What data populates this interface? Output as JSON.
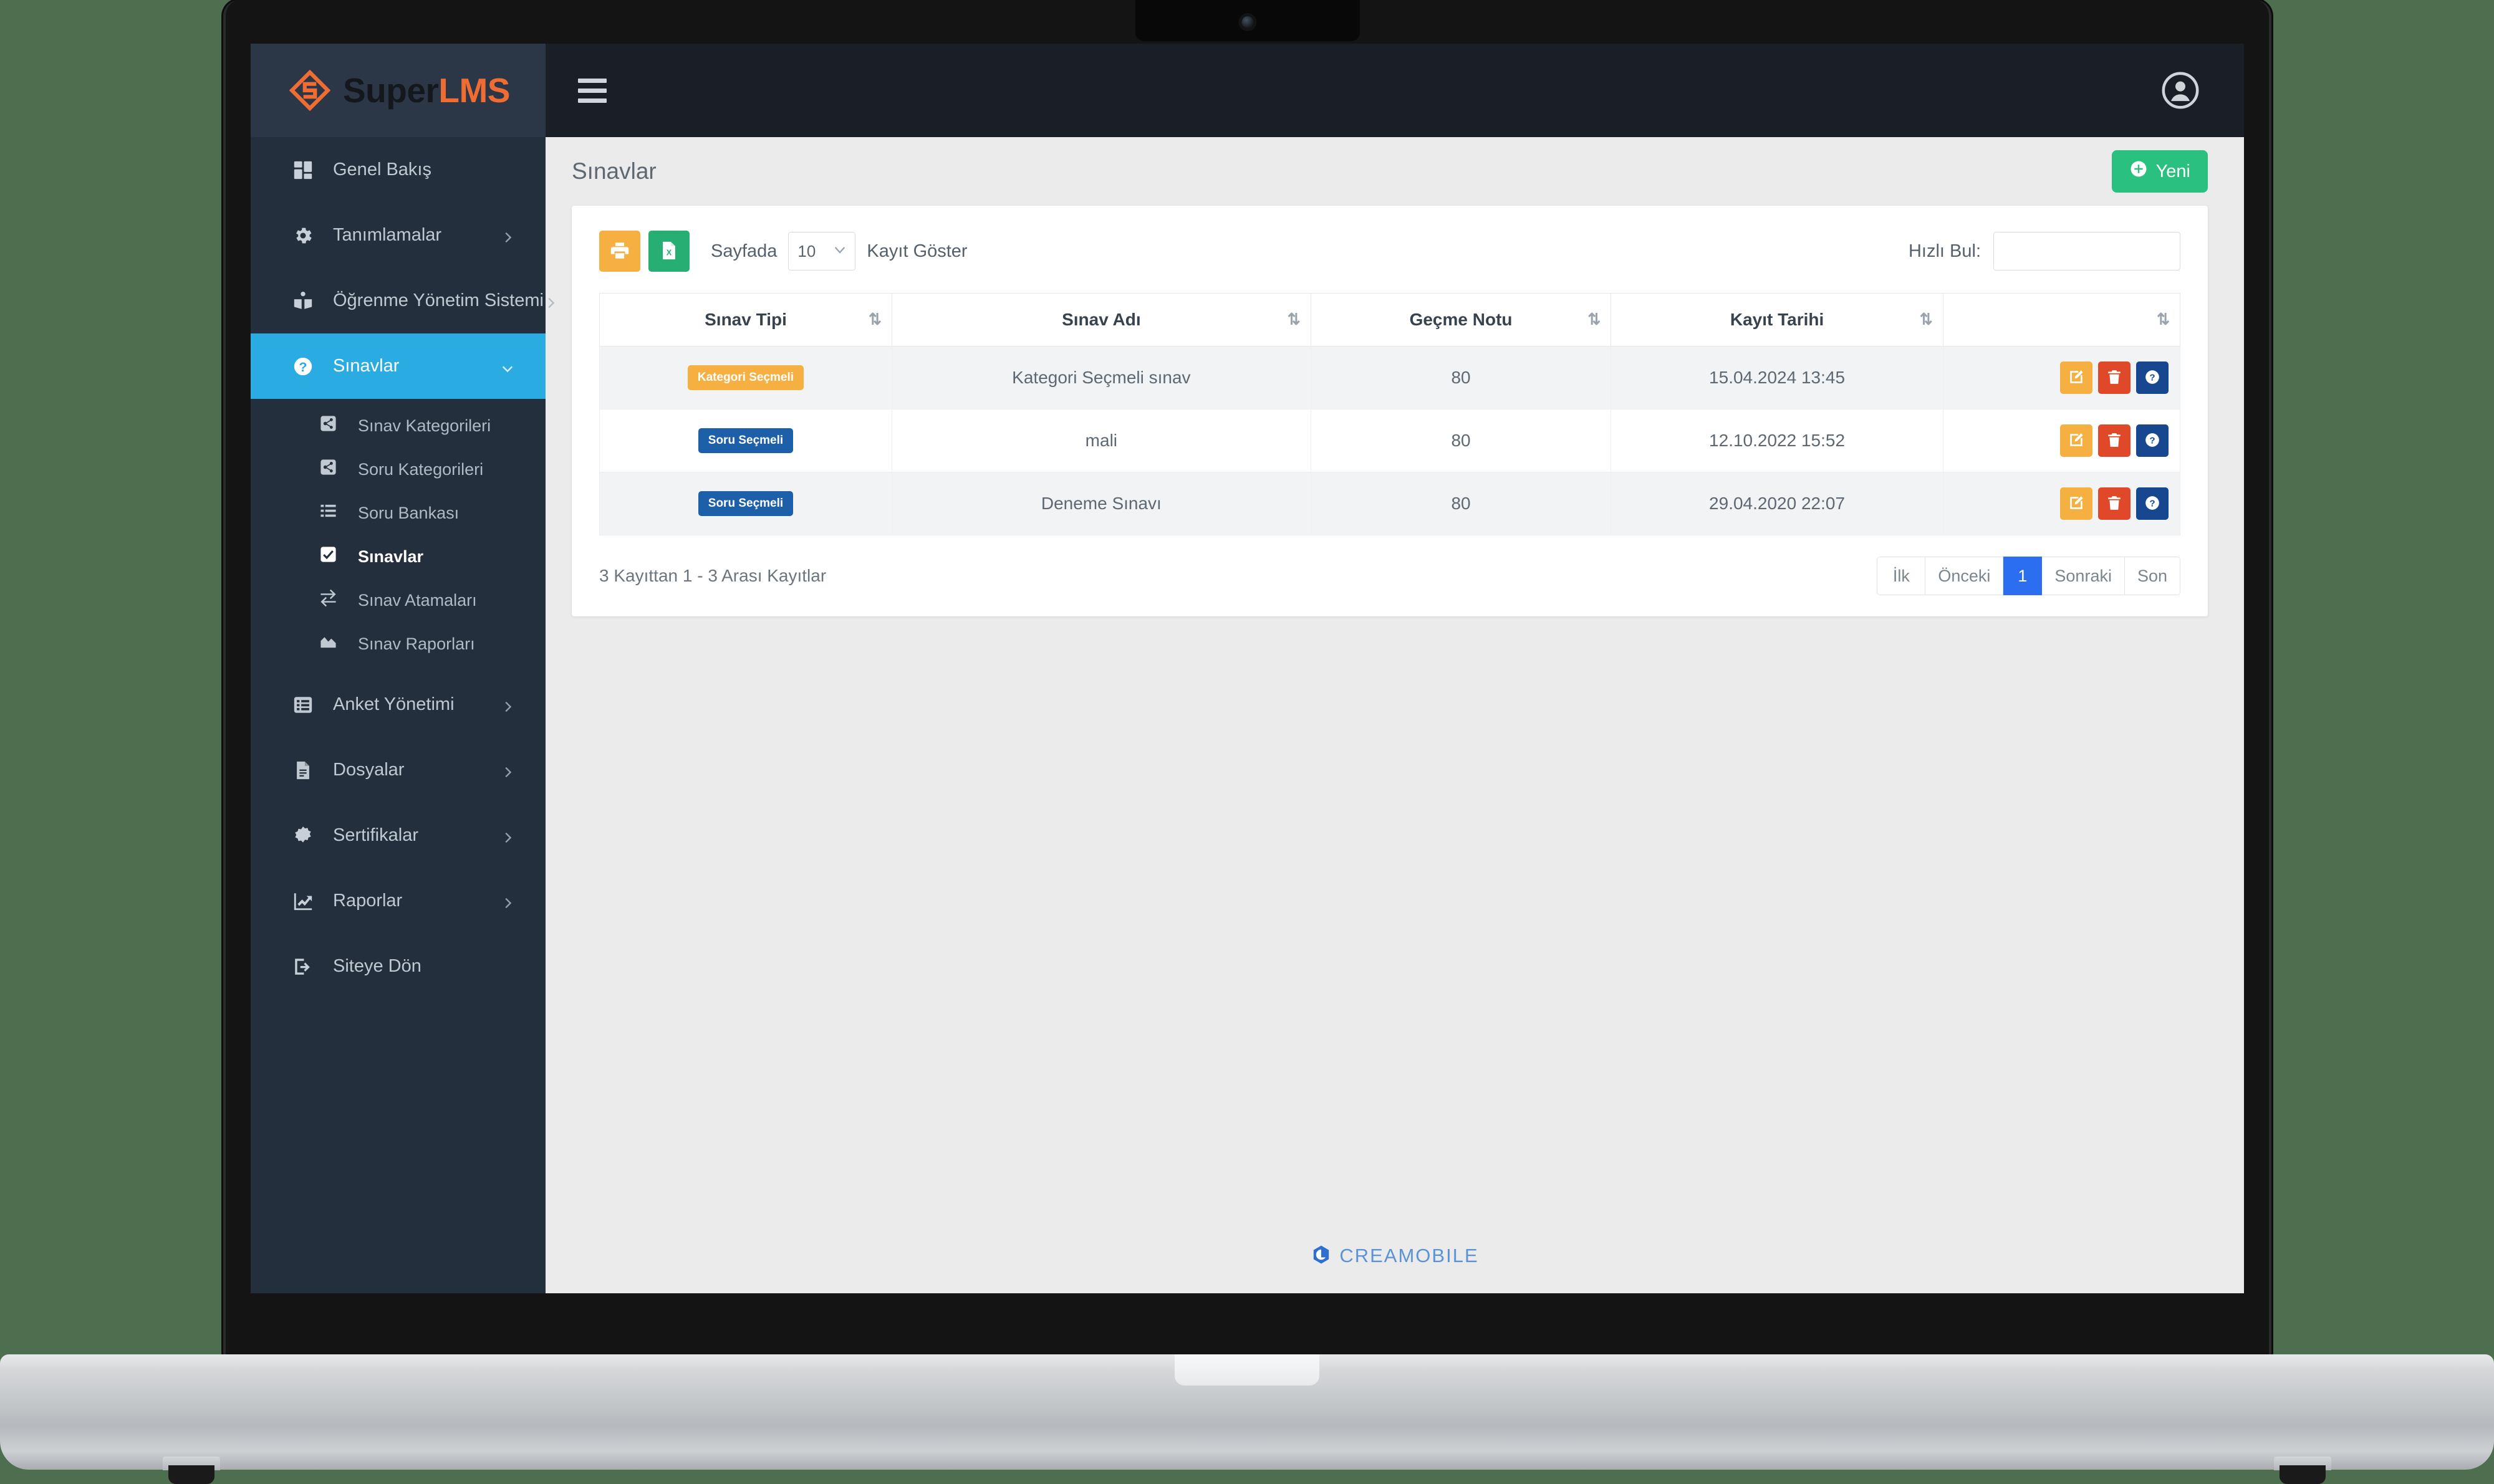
{
  "brand": {
    "name_primary": "Super",
    "name_accent": "LMS",
    "accent_color": "#ef6c33"
  },
  "topbar": {
    "menu_toggle_label": "menu",
    "user_menu_label": "user"
  },
  "page": {
    "title": "Sınavlar",
    "new_button_label": "Yeni"
  },
  "sidebar": {
    "items": [
      {
        "label": "Genel Bakış",
        "icon": "dashboard-icon",
        "has_caret": false,
        "active": false
      },
      {
        "label": "Tanımlamalar",
        "icon": "gear-icon",
        "has_caret": true,
        "active": false
      },
      {
        "label": "Öğrenme Yönetim Sistemi",
        "icon": "graduation-icon",
        "has_caret": true,
        "active": false
      },
      {
        "label": "Sınavlar",
        "icon": "question-circle-icon",
        "has_caret": true,
        "active": true
      }
    ],
    "submenu": [
      {
        "label": "Sınav Kategorileri",
        "icon": "sitemap-icon",
        "current": false
      },
      {
        "label": "Soru Kategorileri",
        "icon": "sitemap-icon",
        "current": false
      },
      {
        "label": "Soru Bankası",
        "icon": "list-icon",
        "current": false
      },
      {
        "label": "Sınavlar",
        "icon": "check-square-icon",
        "current": true
      },
      {
        "label": "Sınav Atamaları",
        "icon": "exchange-icon",
        "current": false
      },
      {
        "label": "Sınav Raporları",
        "icon": "chart-area-icon",
        "current": false
      }
    ],
    "items_after": [
      {
        "label": "Anket Yönetimi",
        "icon": "table-list-icon",
        "has_caret": true
      },
      {
        "label": "Dosyalar",
        "icon": "file-icon",
        "has_caret": true
      },
      {
        "label": "Sertifikalar",
        "icon": "certificate-icon",
        "has_caret": true
      },
      {
        "label": "Raporlar",
        "icon": "chart-line-icon",
        "has_caret": true
      },
      {
        "label": "Siteye Dön",
        "icon": "sign-out-icon",
        "has_caret": false
      }
    ]
  },
  "toolbar": {
    "print_button_label": "print",
    "excel_button_label": "excel",
    "length_prefix": "Sayfada",
    "length_value": "10",
    "length_suffix": "Kayıt Göster",
    "search_label": "Hızlı Bul:",
    "search_value": "",
    "search_placeholder": ""
  },
  "table": {
    "columns": [
      {
        "label": "Sınav Tipi",
        "sortable": true
      },
      {
        "label": "Sınav Adı",
        "sortable": true
      },
      {
        "label": "Geçme Notu",
        "sortable": true
      },
      {
        "label": "Kayıt Tarihi",
        "sortable": true
      },
      {
        "label": "",
        "sortable": true
      }
    ],
    "rows": [
      {
        "type_badge": "Kategori Seçmeli",
        "type_badge_style": "kategori",
        "name": "Kategori Seçmeli sınav",
        "pass_grade": "80",
        "created_at": "15.04.2024 13:45"
      },
      {
        "type_badge": "Soru Seçmeli",
        "type_badge_style": "soru",
        "name": "mali",
        "pass_grade": "80",
        "created_at": "12.10.2022 15:52"
      },
      {
        "type_badge": "Soru Seçmeli",
        "type_badge_style": "soru",
        "name": "Deneme Sınavı",
        "pass_grade": "80",
        "created_at": "29.04.2020 22:07"
      }
    ],
    "row_actions": [
      {
        "name": "edit-button",
        "style": "act-edit",
        "icon": "pencil-square-icon"
      },
      {
        "name": "delete-button",
        "style": "act-delete",
        "icon": "trash-icon"
      },
      {
        "name": "info-button",
        "style": "act-info",
        "icon": "question-circle-icon"
      }
    ]
  },
  "footer_table": {
    "record_info": "3 Kayıttan 1 - 3 Arası Kayıtlar",
    "pagination": [
      {
        "label": "İlk",
        "active": false
      },
      {
        "label": "Önceki",
        "active": false
      },
      {
        "label": "1",
        "active": true
      },
      {
        "label": "Sonraki",
        "active": false
      },
      {
        "label": "Son",
        "active": false
      }
    ]
  },
  "app_footer": {
    "logo_text": "CREAMOBILE",
    "logo_color": "#5b93d6"
  }
}
